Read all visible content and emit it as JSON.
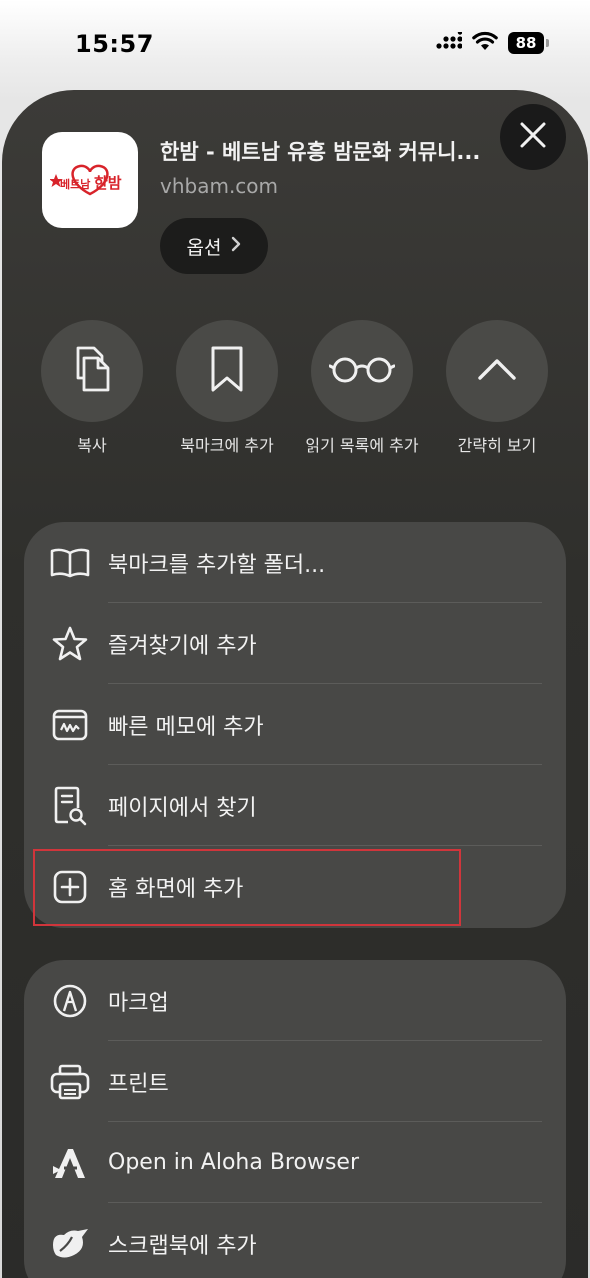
{
  "status_bar": {
    "time": "15:57",
    "battery": "88"
  },
  "site": {
    "title": "한밤 - 베트남 유흥 밤문화 커뮤니...",
    "url": "vhbam.com",
    "logo_text": "베트남 한밤",
    "options_label": "옵션"
  },
  "quick_actions": [
    {
      "label": "복사",
      "icon": "copy-icon"
    },
    {
      "label": "북마크에 추가",
      "icon": "bookmark-icon"
    },
    {
      "label": "읽기 목록에 추가",
      "icon": "glasses-icon"
    },
    {
      "label": "간략히 보기",
      "icon": "chevron-up-icon"
    }
  ],
  "menu_group_1": [
    {
      "label": "북마크를 추가할 폴더...",
      "icon": "book-icon"
    },
    {
      "label": "즐겨찾기에 추가",
      "icon": "star-icon"
    },
    {
      "label": "빠른 메모에 추가",
      "icon": "quick-note-icon"
    },
    {
      "label": "페이지에서 찾기",
      "icon": "find-in-page-icon"
    },
    {
      "label": "홈 화면에 추가",
      "icon": "add-square-icon"
    }
  ],
  "menu_group_2": [
    {
      "label": "마크업",
      "icon": "markup-icon"
    },
    {
      "label": "프린트",
      "icon": "printer-icon"
    },
    {
      "label": "Open in Aloha Browser",
      "icon": "aloha-icon"
    },
    {
      "label": "스크랩북에 추가",
      "icon": "scrapbook-icon"
    }
  ],
  "colors": {
    "sheet_bg": "#2f2f2c",
    "group_bg": "#484846",
    "highlight": "#d0353b",
    "logo_red": "#d8232a"
  }
}
